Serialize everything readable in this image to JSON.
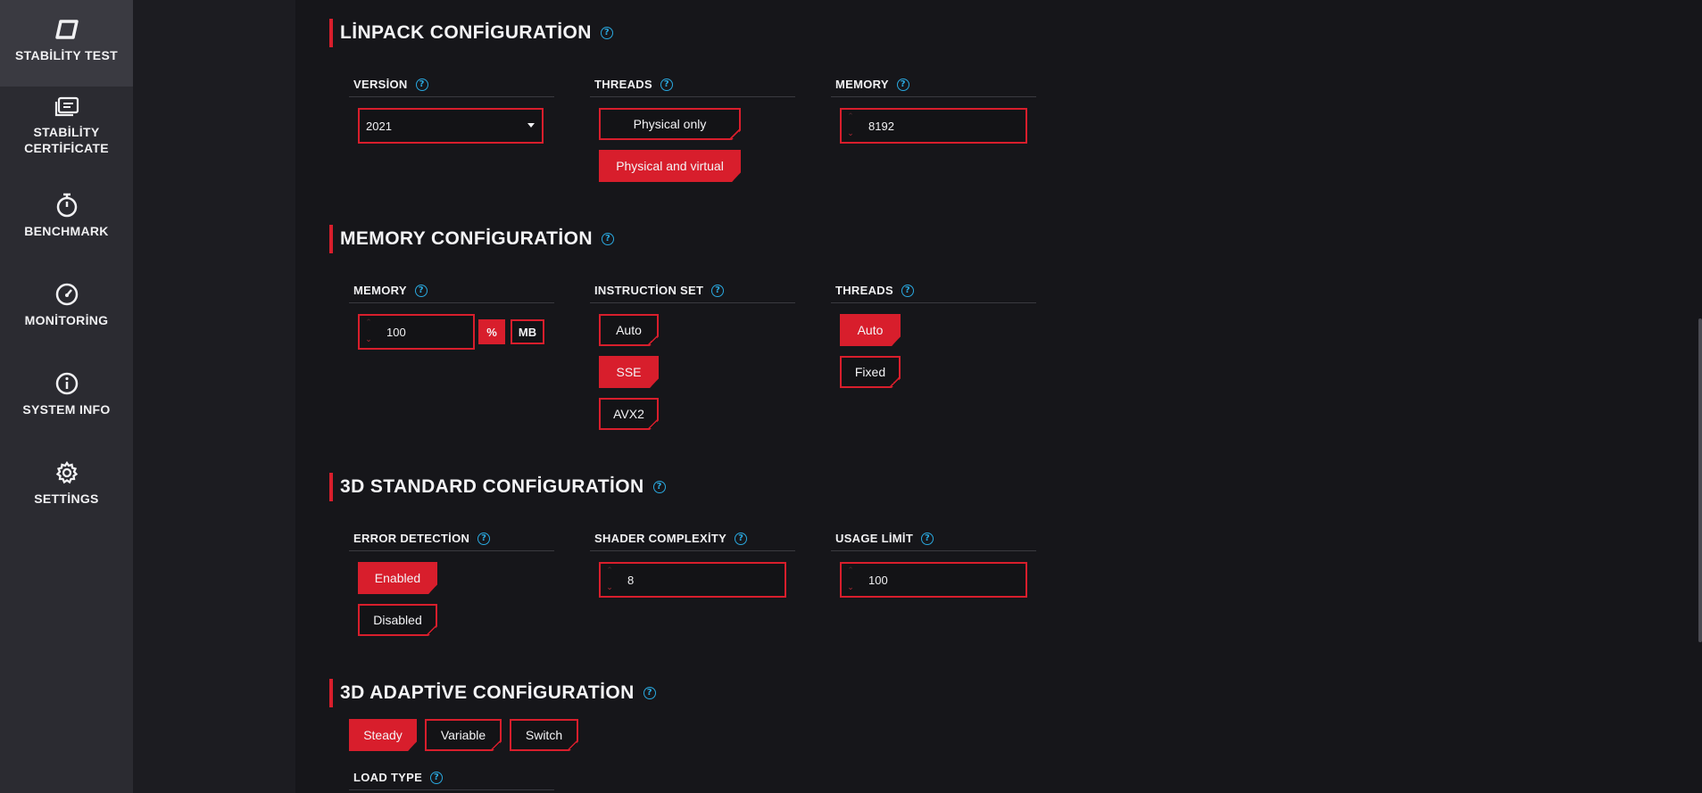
{
  "sidebar": {
    "items": [
      {
        "label": "STABİLİTY TEST",
        "icon": "stability-test-icon",
        "active": true
      },
      {
        "label": "STABİLİTY\nCERTİFİCATE",
        "icon": "certificate-icon",
        "active": false
      },
      {
        "label": "BENCHMARK",
        "icon": "stopwatch-icon",
        "active": false
      },
      {
        "label": "MONİTORİNG",
        "icon": "gauge-icon",
        "active": false
      },
      {
        "label": "SYSTEM INFO",
        "icon": "info-icon",
        "active": false
      },
      {
        "label": "SETTİNGS",
        "icon": "gear-icon",
        "active": false
      }
    ]
  },
  "linpack": {
    "title": "LİNPACK CONFİGURATİON",
    "version_label": "VERSİON",
    "version_value": "2021",
    "threads_label": "THREADS",
    "threads_options": [
      "Physical only",
      "Physical and virtual"
    ],
    "threads_selected": "Physical and virtual",
    "memory_label": "MEMORY",
    "memory_value": "8192"
  },
  "memory_config": {
    "title": "MEMORY CONFİGURATİON",
    "memory_label": "MEMORY",
    "memory_value": "100",
    "unit_percent": "%",
    "unit_mb": "MB",
    "unit_selected": "%",
    "instruction_label": "INSTRUCTİON SET",
    "instruction_options": [
      "Auto",
      "SSE",
      "AVX2"
    ],
    "instruction_selected": "SSE",
    "threads_label": "THREADS",
    "threads_options": [
      "Auto",
      "Fixed"
    ],
    "threads_selected": "Auto"
  },
  "standard3d": {
    "title": "3D STANDARD CONFİGURATİON",
    "error_label": "ERROR DETECTİON",
    "error_options": [
      "Enabled",
      "Disabled"
    ],
    "error_selected": "Enabled",
    "shader_label": "SHADER COMPLEXİTY",
    "shader_value": "8",
    "usage_label": "USAGE LİMİT",
    "usage_value": "100"
  },
  "adaptive3d": {
    "title": "3D ADAPTİVE CONFİGURATİON",
    "mode_options": [
      "Steady",
      "Variable",
      "Switch"
    ],
    "mode_selected": "Steady",
    "load_type_label": "LOAD TYPE"
  },
  "help_glyph": "?",
  "colors": {
    "accent": "#d81e2c",
    "help": "#2aa9e0",
    "background": "#16161a",
    "sidebar": "#2b2b31"
  }
}
